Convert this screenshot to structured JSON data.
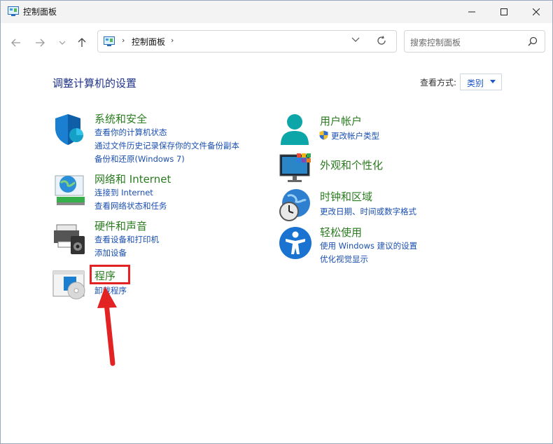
{
  "window": {
    "title": "控制面板"
  },
  "nav": {
    "breadcrumb": "控制面板",
    "search_placeholder": "搜索控制面板"
  },
  "main": {
    "heading": "调整计算机的设置",
    "view_by_label": "查看方式:",
    "view_by_value": "类别"
  },
  "categories": {
    "security": {
      "title": "系统和安全",
      "links": [
        "查看你的计算机状态",
        "通过文件历史记录保存你的文件备份副本",
        "备份和还原(Windows 7)"
      ]
    },
    "network": {
      "title": "网络和 Internet",
      "links": [
        "连接到 Internet",
        "查看网络状态和任务"
      ]
    },
    "hardware": {
      "title": "硬件和声音",
      "links": [
        "查看设备和打印机",
        "添加设备"
      ]
    },
    "programs": {
      "title": "程序",
      "links": [
        "卸载程序"
      ]
    },
    "user": {
      "title": "用户帐户",
      "links": [
        "更改帐户类型"
      ]
    },
    "appearance": {
      "title": "外观和个性化",
      "links": []
    },
    "clock": {
      "title": "时钟和区域",
      "links": [
        "更改日期、时间或数字格式"
      ]
    },
    "ease": {
      "title": "轻松使用",
      "links": [
        "使用 Windows 建议的设置",
        "优化视觉显示"
      ]
    }
  },
  "colors": {
    "category_title": "#2a7c1f",
    "link": "#1a4fb0",
    "heading": "#1e3287",
    "highlight": "#e32323"
  }
}
